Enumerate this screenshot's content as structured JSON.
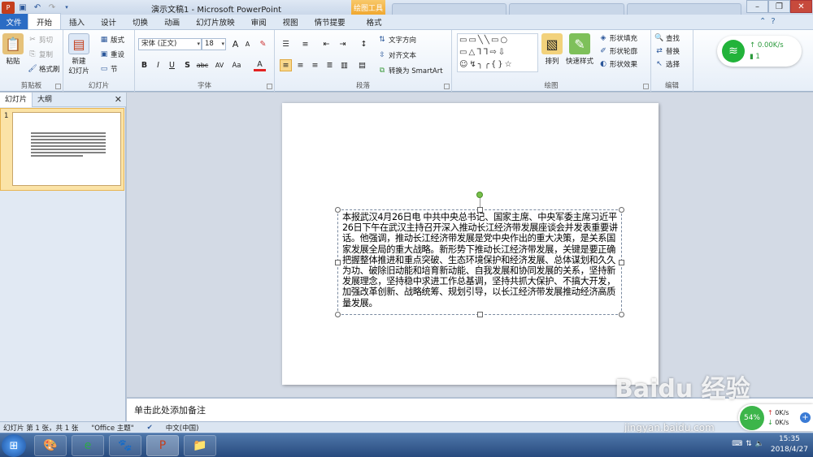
{
  "window": {
    "title": "演示文稿1  -  Microsoft PowerPoint",
    "context_tool": "绘图工具",
    "bg_tabs": [
      "",
      "",
      ""
    ]
  },
  "ribbon_tabs": [
    "文件",
    "开始",
    "插入",
    "设计",
    "切换",
    "动画",
    "幻灯片放映",
    "审阅",
    "视图",
    "情节提要",
    "格式"
  ],
  "clipboard": {
    "paste": "粘贴",
    "cut": "剪切",
    "copy": "复制",
    "painter": "格式刷",
    "label": "剪贴板"
  },
  "slides_group": {
    "new": "新建",
    "new2": "幻灯片",
    "layout": "版式",
    "reset": "重设",
    "section": "节",
    "label": "幻灯片"
  },
  "font_group": {
    "font": "宋体 (正文)",
    "size": "18",
    "label": "字体",
    "bold": "B",
    "italic": "I",
    "underline": "U",
    "shadow": "S",
    "strike": "abc",
    "spacing": "AV",
    "case": "Aa",
    "color": "A",
    "grow": "A",
    "shrink": "A"
  },
  "para_group": {
    "label": "段落",
    "dir": "文字方向",
    "align": "对齐文本",
    "smartart": "转换为 SmartArt"
  },
  "draw_group": {
    "arrange": "排列",
    "quick": "快速样式",
    "fill": "形状填充",
    "outline": "形状轮廓",
    "effect": "形状效果",
    "label": "绘图"
  },
  "edit_group": {
    "find": "查找",
    "replace": "替换",
    "select": "选择",
    "label": "编辑"
  },
  "net_widget": {
    "speed": "0.00K/s",
    "count": "1"
  },
  "left_pane": {
    "tab1": "幻灯片",
    "tab2": "大纲",
    "slide_num": "1"
  },
  "slide_text": "本报武汉4月26日电 中共中央总书记、国家主席、中央军委主席习近平26日下午在武汉主持召开深入推动长江经济带发展座谈会并发表重要讲话。他强调，推动长江经济带发展是党中央作出的重大决策，是关系国家发展全局的重大战略。新形势下推动长江经济带发展，关键是要正确把握整体推进和重点突破、生态环境保护和经济发展、总体谋划和久久为功、破除旧动能和培育新动能、自我发展和协同发展的关系，坚持新发展理念，坚持稳中求进工作总基调，坚持共抓大保护、不搞大开发，加强改革创新、战略统筹、规划引导，以长江经济带发展推动经济高质量发展。",
  "notes_placeholder": "单击此处添加备注",
  "status": {
    "slide": "幻灯片 第 1 张，共 1 张",
    "theme": "\"Office 主题\"",
    "lang": "中文(中国)"
  },
  "taskbar": {
    "time": "15:35",
    "date": "2018/4/27"
  },
  "speed_widget": {
    "pct": "54%",
    "up": "0K/s",
    "down": "0K/s"
  },
  "watermark": {
    "logo": "Baidu 经验",
    "url": "jingyan.baidu.com"
  },
  "colors": {
    "accent": "#2b6cc4",
    "context": "#f0a830",
    "green": "#22b33a"
  }
}
